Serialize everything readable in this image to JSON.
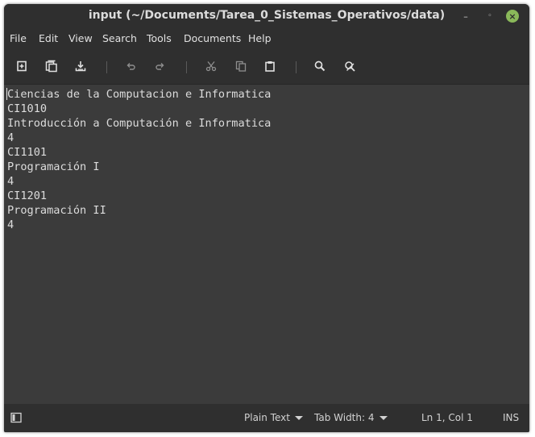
{
  "window": {
    "title": "input (~/Documents/Tarea_0_Sistemas_Operativos/data)",
    "minimize_glyph": "–",
    "maximize_glyph": "◦",
    "close_glyph": "×"
  },
  "menu": {
    "items": [
      {
        "label": "File"
      },
      {
        "label": "Edit"
      },
      {
        "label": "View"
      },
      {
        "label": "Search"
      },
      {
        "label": "Tools"
      },
      {
        "label": "Documents"
      },
      {
        "label": "Help"
      }
    ]
  },
  "toolbar": {
    "buttons": [
      {
        "icon": "new-document-icon"
      },
      {
        "icon": "open-copy-icon"
      },
      {
        "icon": "save-download-icon"
      },
      {
        "icon": "undo-icon"
      },
      {
        "icon": "redo-icon"
      },
      {
        "icon": "cut-icon"
      },
      {
        "icon": "copy-icon"
      },
      {
        "icon": "paste-icon"
      },
      {
        "icon": "search-icon"
      },
      {
        "icon": "replace-icon"
      }
    ]
  },
  "editor": {
    "lines": [
      "Ciencias de la Computacion e Informatica",
      "CI1010",
      "Introducción a Computación e Informatica",
      "4",
      "CI1101",
      "Programación I",
      "4",
      "CI1201",
      "Programación II",
      "4"
    ]
  },
  "status": {
    "syntax": "Plain Text",
    "tab_width_label": "Tab Width:",
    "tab_width_value": "4",
    "position": "Ln 1, Col 1",
    "mode": "INS"
  },
  "colors": {
    "window_bg": "#2f2f2f",
    "editor_bg": "#3b3b3b",
    "text": "#dcdcdc",
    "close_button": "#8ab85a"
  }
}
